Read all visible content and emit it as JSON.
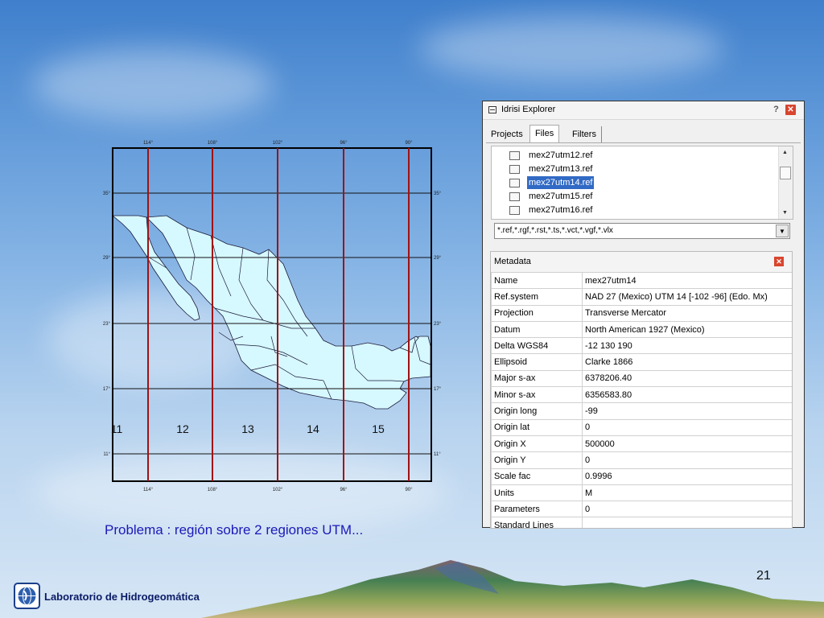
{
  "map": {
    "top_lon_labels": [
      "114°",
      "108°",
      "102°",
      "96°",
      "90°"
    ],
    "bottom_lon_labels": [
      "114°",
      "108°",
      "102°",
      "96°",
      "90°"
    ],
    "left_lat_labels": [
      "35°",
      "29°",
      "23°",
      "17°",
      "11°"
    ],
    "right_lat_labels": [
      "35°",
      "29°",
      "23°",
      "17°",
      "11°"
    ],
    "zones": [
      "11",
      "12",
      "13",
      "14",
      "15"
    ],
    "colors": {
      "land": "#d6f8ff",
      "zone_line": "#a01212",
      "grid": "#111111"
    }
  },
  "explorer": {
    "title": "Idrisi Explorer",
    "help_symbol": "?",
    "close_symbol": "✕",
    "tabs": [
      "Projects",
      "Files",
      "Filters"
    ],
    "active_tab": "Files",
    "files": [
      "mex27utm12.ref",
      "mex27utm13.ref",
      "mex27utm14.ref",
      "mex27utm15.ref",
      "mex27utm16.ref"
    ],
    "selected_file": "mex27utm14.ref",
    "filter_text": "*.ref,*.rgf,*.rst,*.ts,*.vct,*.vgf,*.vlx",
    "metadata": {
      "header": "Metadata",
      "rows": [
        [
          "Name",
          "mex27utm14"
        ],
        [
          "Ref.system",
          "NAD 27 (Mexico) UTM 14 [-102 -96] (Edo. Mx)"
        ],
        [
          "Projection",
          "Transverse Mercator"
        ],
        [
          "Datum",
          "North American 1927 (Mexico)"
        ],
        [
          "Delta WGS84",
          "-12 130 190"
        ],
        [
          "Ellipsoid",
          "Clarke 1866"
        ],
        [
          "Major s-ax",
          "6378206.40"
        ],
        [
          "Minor s-ax",
          "6356583.80"
        ],
        [
          "Origin long",
          "-99"
        ],
        [
          "Origin lat",
          "0"
        ],
        [
          "Origin X",
          "500000"
        ],
        [
          "Origin Y",
          "0"
        ],
        [
          "Scale fac",
          "0.9996"
        ],
        [
          "Units",
          "M"
        ],
        [
          "Parameters",
          "0"
        ],
        [
          "Standard Lines",
          ""
        ]
      ]
    }
  },
  "caption": "Problema : región sobre 2 regiones UTM...",
  "page_number": "21",
  "footer": {
    "lab_name": "Laboratorio de Hidrogeomática"
  }
}
